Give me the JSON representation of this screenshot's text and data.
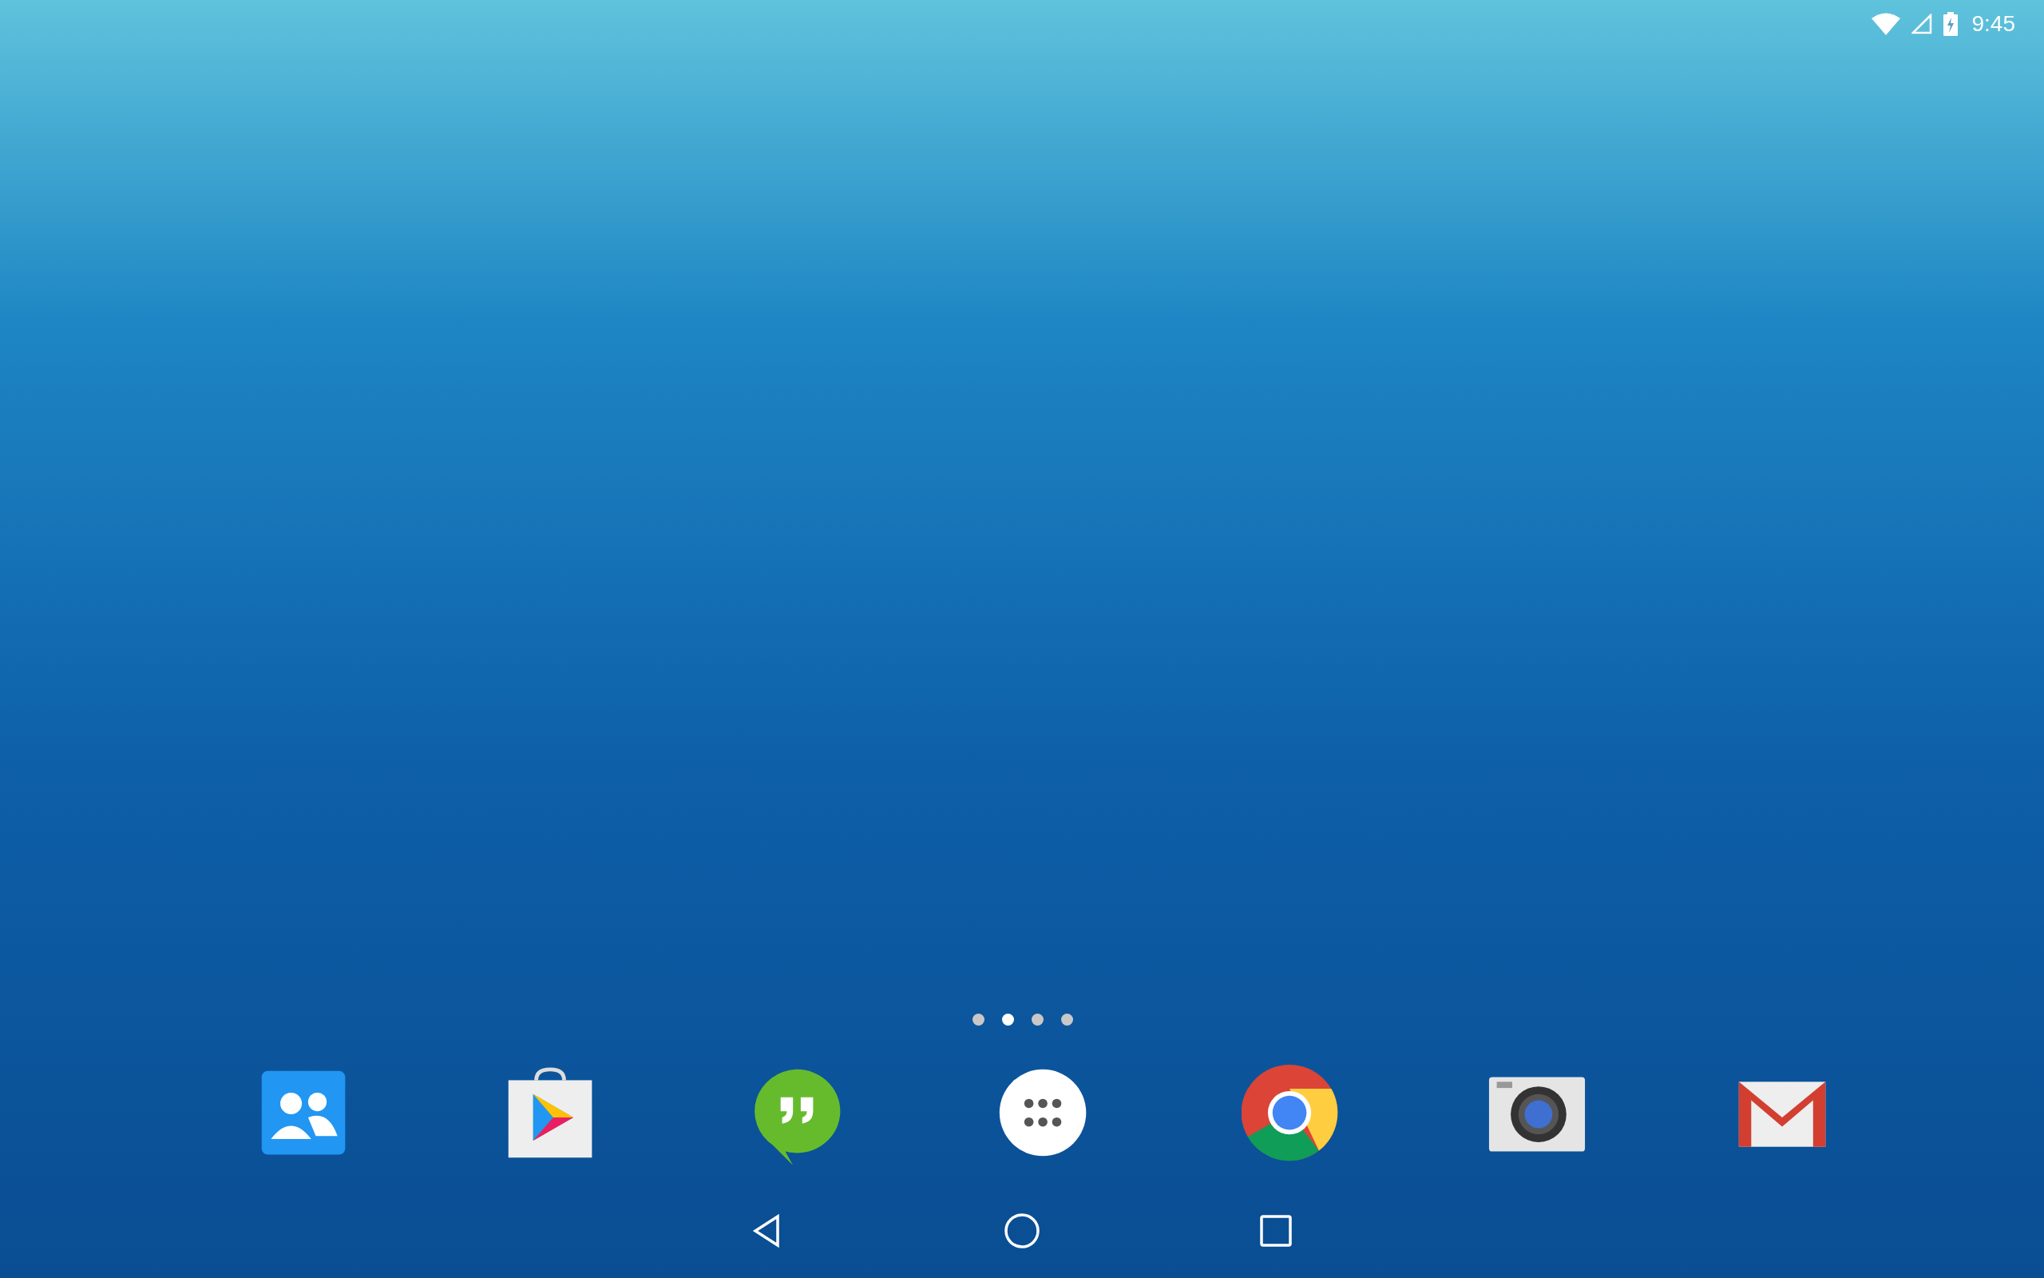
{
  "status_bar": {
    "time": "9:45"
  },
  "page_indicator": [
    {
      "selected": false
    },
    {
      "selected": true
    },
    {
      "selected": false
    },
    {
      "selected": false
    }
  ],
  "dock": [
    {
      "kind": "people"
    },
    {
      "kind": "store"
    },
    {
      "kind": "chat"
    },
    {
      "kind": "apps"
    },
    {
      "kind": "browser"
    },
    {
      "kind": "camera"
    },
    {
      "kind": "mail"
    }
  ],
  "nav_bar": [
    {
      "kind": "back"
    },
    {
      "kind": "home"
    },
    {
      "kind": "recents"
    }
  ]
}
